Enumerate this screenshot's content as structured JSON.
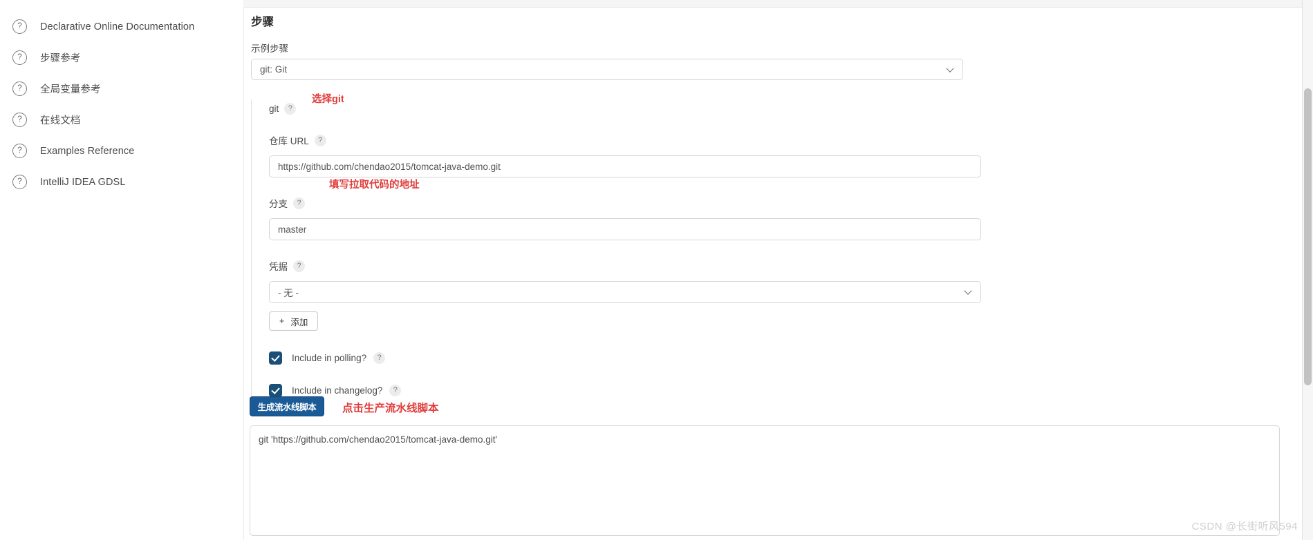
{
  "sidebar": {
    "items": [
      {
        "icon": "help-circle-icon",
        "label": "Declarative Online Documentation"
      },
      {
        "icon": "help-circle-icon",
        "label": "步骤参考"
      },
      {
        "icon": "help-circle-icon",
        "label": "全局变量参考"
      },
      {
        "icon": "help-circle-icon",
        "label": "在线文档"
      },
      {
        "icon": "help-circle-icon",
        "label": "Examples Reference"
      },
      {
        "icon": "help-circle-icon",
        "label": "IntelliJ IDEA GDSL"
      }
    ]
  },
  "main": {
    "section_title": "步骤",
    "sample_step": {
      "label": "示例步骤",
      "value": "git: Git",
      "chevron": "chevron-down-icon"
    },
    "git_block": {
      "title": "git",
      "hint": "?",
      "repo_url": {
        "label": "仓库 URL",
        "hint": "?",
        "value": "https://github.com/chendao2015/tomcat-java-demo.git"
      },
      "branch": {
        "label": "分支",
        "hint": "?",
        "value": "master"
      },
      "credentials": {
        "label": "凭据",
        "hint": "?",
        "value": "- 无 -",
        "chevron": "chevron-down-icon",
        "add_button": {
          "plus": "+",
          "label": "添加"
        }
      },
      "checkboxes": [
        {
          "label": "Include in polling?",
          "hint": "?",
          "checked": true
        },
        {
          "label": "Include in changelog?",
          "hint": "?",
          "checked": true
        }
      ]
    },
    "generate_button": "生成流水线脚本",
    "output_script": "git 'https://github.com/chendao2015/tomcat-java-demo.git'"
  },
  "annotations": [
    {
      "text": "选择git"
    },
    {
      "text": "填写拉取代码的地址"
    },
    {
      "text": "点击生产流水线脚本"
    }
  ],
  "watermark": "CSDN @长街听风594",
  "colors": {
    "accent_blue": "#1a5a96",
    "checkbox_blue": "#1a4f78",
    "annotation_red": "#e23b3b"
  }
}
